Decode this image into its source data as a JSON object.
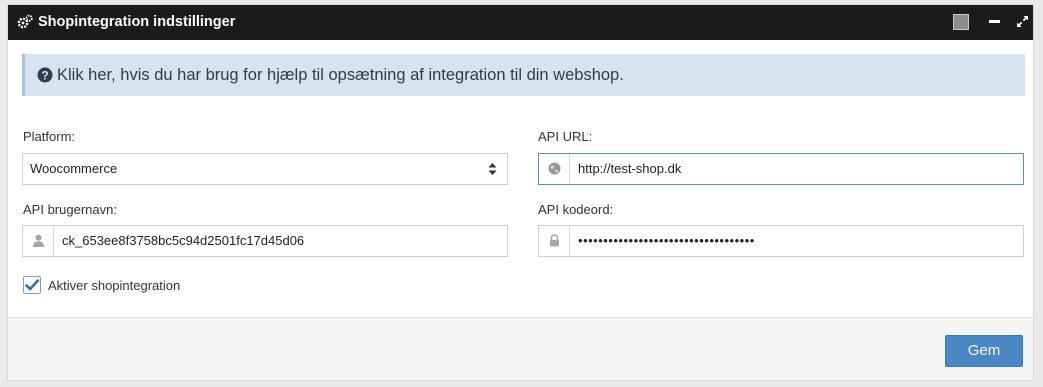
{
  "window": {
    "title": "Shopintegration indstillinger",
    "icons": [
      "gears-icon",
      "restore-icon",
      "minimize-icon",
      "expand-icon"
    ]
  },
  "help": {
    "text": "Klik her, hvis du har brug for hjælp til opsætning af integration til din webshop.",
    "icon": "question-circle-icon"
  },
  "form": {
    "platform_label": "Platform:",
    "platform_value": "Woocommerce",
    "api_url_label": "API URL:",
    "api_url_value": "http://test-shop.dk",
    "api_user_label": "API brugernavn:",
    "api_user_value": "ck_653ee8f3758bc5c94d2501fc17d45d06",
    "api_password_label": "API kodeord:",
    "api_password_value": "•••••••••••••••••••••••••••••••••••",
    "activate_label": "Aktiver shopintegration",
    "activate_checked": true
  },
  "footer": {
    "save_label": "Gem"
  },
  "colors": {
    "header_bg": "#1b1b1b",
    "alert_bg": "#d8e3f0",
    "primary": "#4a87c5"
  }
}
